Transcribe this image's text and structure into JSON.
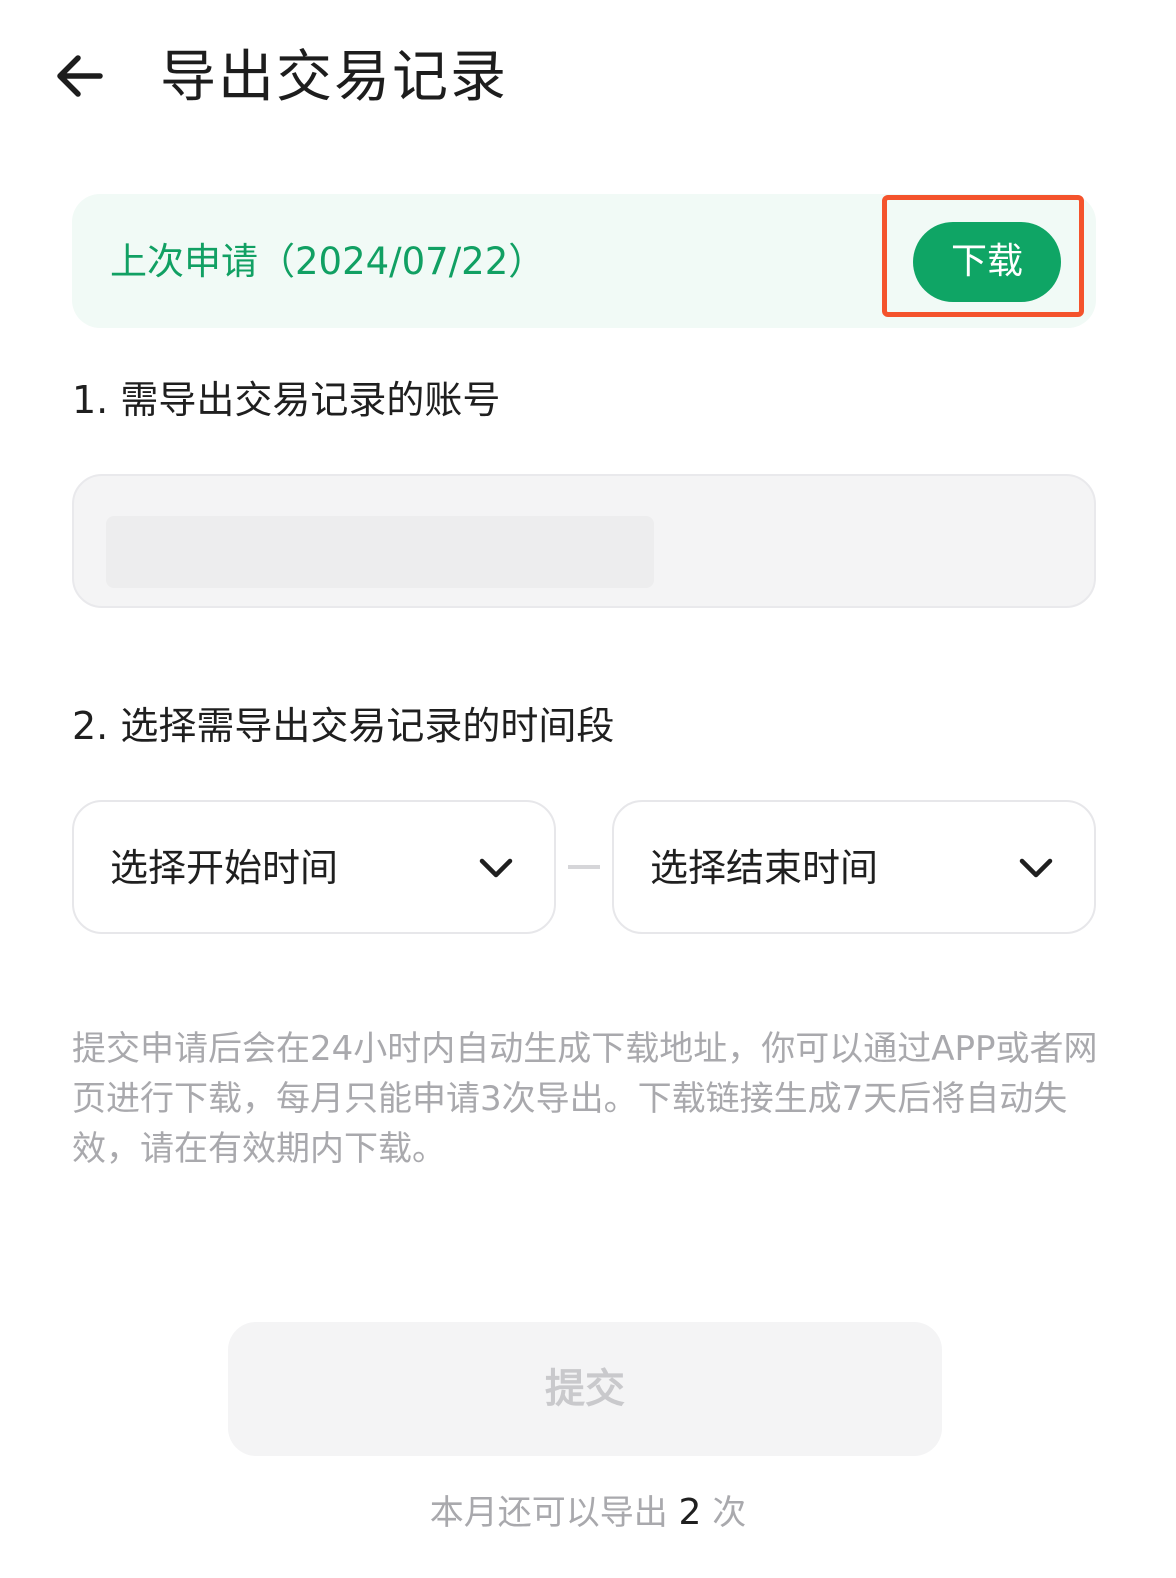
{
  "header": {
    "back_icon": "arrow-left-icon",
    "title": "导出交易记录"
  },
  "last_request": {
    "label": "上次申请",
    "date": "（2024/07/22）",
    "download_label": "下载",
    "accent_color": "#0fa565",
    "highlight_color": "#f4532c"
  },
  "section1": {
    "label": "1. 需导出交易记录的账号"
  },
  "section2": {
    "label": "2. 选择需导出交易记录的时间段",
    "start_label": "选择开始时间",
    "end_label": "选择结束时间",
    "chevron_icon": "chevron-down-icon"
  },
  "notice": "提交申请后会在24小时内自动生成下载地址，你可以通过APP或者网页进行下载，每月只能申请3次导出。下载链接生成7天后将自动失效，请在有效期内下载。",
  "submit": {
    "label": "提交"
  },
  "remaining": {
    "prefix": "本月还可以导出",
    "count": "2",
    "suffix": "次"
  }
}
